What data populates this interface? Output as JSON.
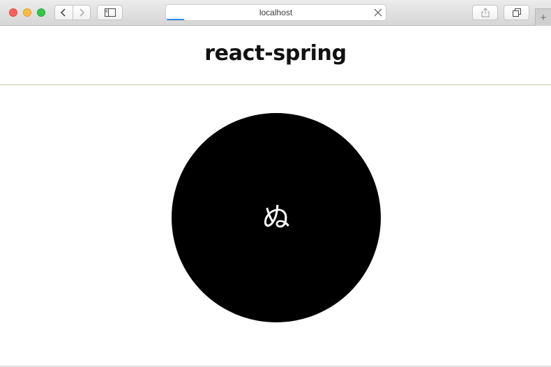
{
  "browser": {
    "address_text": "localhost",
    "new_tab_label": "+",
    "load_progress_percent": 8
  },
  "page": {
    "title": "react-spring",
    "circle_character": "ぬ"
  },
  "colors": {
    "circle": "#000000",
    "circle_text": "#ffffff",
    "header_border": "#c9c7a7",
    "progress": "#2f88f6"
  }
}
